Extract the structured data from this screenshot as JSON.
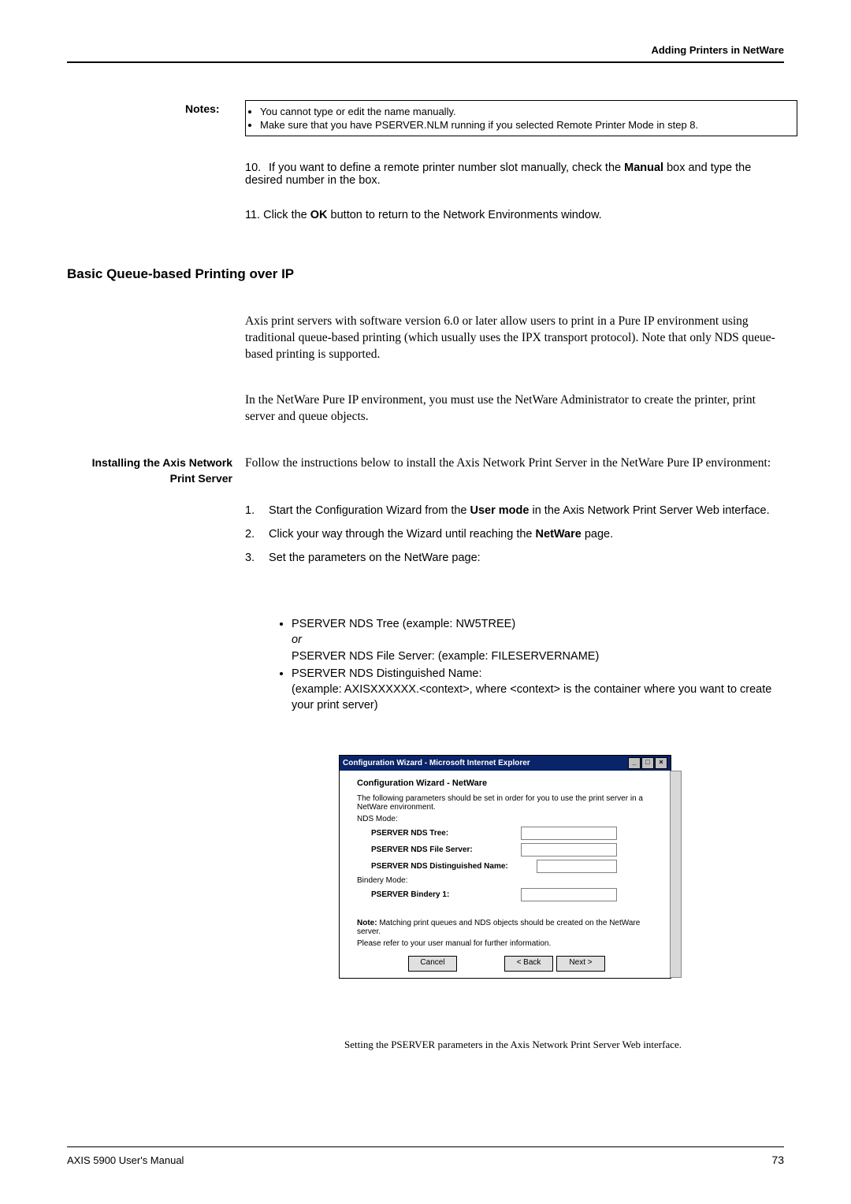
{
  "header": {
    "section": "Adding Printers in NetWare"
  },
  "notes": {
    "label": "Notes:",
    "items": [
      "You cannot type or edit the name manually.",
      "Make sure that you have PSERVER.NLM running if you selected Remote Printer Mode in step 8."
    ]
  },
  "step10": {
    "num": "10.",
    "text_a": "If you want to define a remote printer number slot manually, check the ",
    "bold": "Manual",
    "text_b": " box and type the desired number in the box."
  },
  "step11": {
    "num": "11.",
    "text_a": "Click the ",
    "bold": "OK",
    "text_b": " button to return to the Network Environments window."
  },
  "heading2": "Basic Queue-based Printing over IP",
  "para1": "Axis print servers with software version 6.0 or later allow users to print in a Pure IP environment using traditional queue-based printing (which usually uses the IPX transport protocol). Note that only NDS queue-based printing is supported.",
  "para2": "In the NetWare Pure IP environment, you must use the NetWare Administrator to create the printer, print server and queue objects.",
  "sidehead": "Installing the Axis Network Print Server",
  "para3": "Follow the instructions below to install the Axis Network Print Server in the NetWare Pure IP environment:",
  "ol": [
    {
      "n": "1.",
      "pre": "Start the Configuration Wizard from the ",
      "bold": "User mode",
      "post": " in the Axis Network Print Server Web interface."
    },
    {
      "n": "2.",
      "pre": "Click your way through the Wizard until reaching the ",
      "bold": "NetWare",
      "post": " page."
    },
    {
      "n": "3.",
      "pre": "Set the parameters on the NetWare page:",
      "bold": "",
      "post": ""
    }
  ],
  "sub": {
    "b1a": "PSERVER NDS Tree (example: NW5TREE)",
    "b1or": "or",
    "b1b": "PSERVER NDS File Server: (example: FILESERVERNAME)",
    "b2a": "PSERVER NDS Distinguished Name:",
    "b2b": "(example: AXISXXXXXX.<context>, where <context> is the container where you want to create your print server)"
  },
  "dialog": {
    "title": "Configuration Wizard - Microsoft Internet Explorer",
    "heading": "Configuration Wizard - NetWare",
    "desc": "The following parameters should be set in order for you to use the print server in a NetWare environment.",
    "nds_mode": "NDS Mode:",
    "f1": "PSERVER NDS Tree:",
    "f2": "PSERVER NDS File Server:",
    "f3": "PSERVER NDS Distinguished Name:",
    "bindery_mode": "Bindery Mode:",
    "f4": "PSERVER Bindery 1:",
    "note_bold": "Note:",
    "note_text": " Matching print queues and NDS objects should be created on the NetWare server.",
    "note2": "Please refer to your user manual for further information.",
    "btn_cancel": "Cancel",
    "btn_back": "< Back",
    "btn_next": "Next >",
    "min": "_",
    "max": "□",
    "close": "×"
  },
  "caption": "Setting the PSERVER parameters in the Axis Network Print Server Web interface.",
  "footer": {
    "left": "AXIS 5900 User's Manual",
    "right": "73"
  }
}
